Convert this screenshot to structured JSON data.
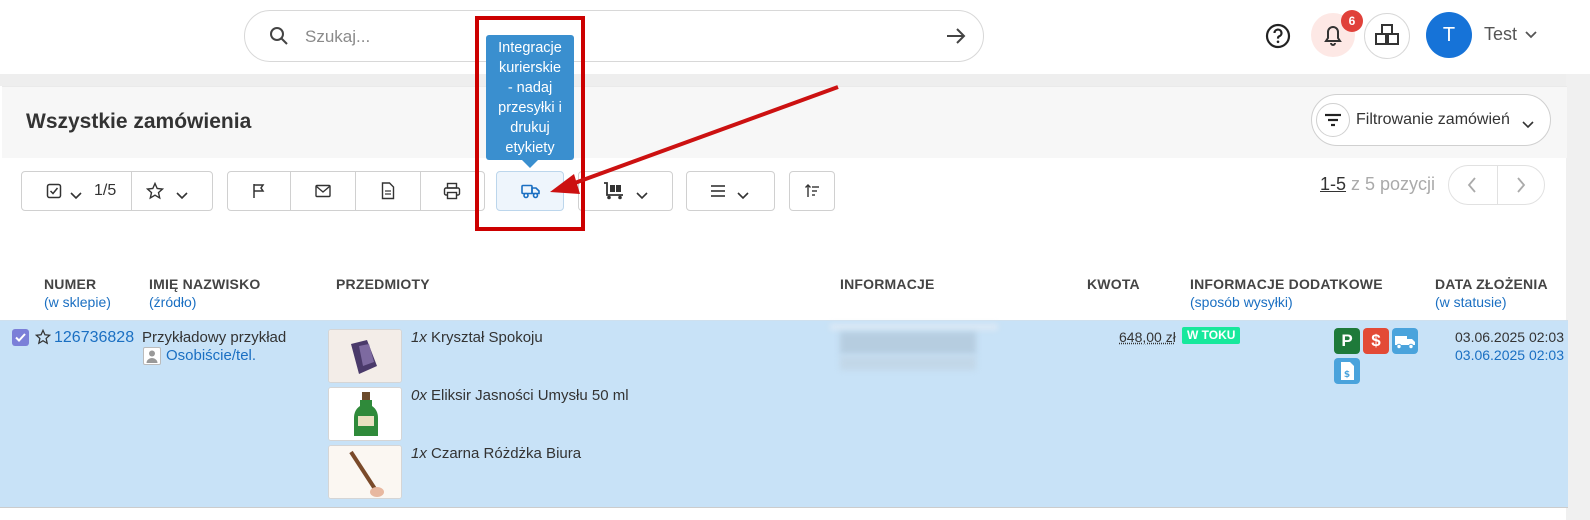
{
  "search": {
    "placeholder": "Szukaj..."
  },
  "header": {
    "notifications_count": "6",
    "avatar_initial": "T",
    "username": "Test"
  },
  "page": {
    "title": "Wszystkie zamówienia",
    "filter_label": "Filtrowanie zamówień"
  },
  "toolbar": {
    "selection_count": "1/5"
  },
  "tooltip": {
    "lines": [
      "Integracje",
      "kurierskie",
      "- nadaj",
      "przesyłki i",
      "drukuj",
      "etykiety"
    ]
  },
  "pagination": {
    "current": "1-5",
    "rest": " z 5 pozycji"
  },
  "table": {
    "headers": [
      {
        "label": "NUMER",
        "sub": "(w sklepie)"
      },
      {
        "label": "IMIĘ NAZWISKO",
        "sub": "(źródło)"
      },
      {
        "label": "PRZEDMIOTY",
        "sub": ""
      },
      {
        "label": "INFORMACJE",
        "sub": ""
      },
      {
        "label": "KWOTA",
        "sub": ""
      },
      {
        "label": "INFORMACJE DODATKOWE",
        "sub": "(sposób wysyłki)"
      },
      {
        "label": "DATA ZŁOŻENIA",
        "sub": "(w statusie)"
      }
    ],
    "rows": [
      {
        "order_number": "126736828",
        "customer_name": "Przykładowy przykład",
        "source": "Osobiście/tel.",
        "items": [
          {
            "qty": "1x",
            "name": " Kryształ Spokoju"
          },
          {
            "qty": "0x",
            "name": " Eliksir Jasności Umysłu 50 ml"
          },
          {
            "qty": "1x",
            "name": " Czarna Różdżka Biura"
          }
        ],
        "amount": "648,00 zł",
        "status": "W TOKU",
        "flags": [
          "P",
          "$"
        ],
        "date_created": "03.06.2025 02:03",
        "date_status": "03.06.2025 02:03"
      }
    ]
  },
  "colors": {
    "accent": "#1a6fc2",
    "row_selected": "#c8e2f7",
    "tooltip": "#3a8fcf",
    "highlight": "#cc0000",
    "status": "#17e89c"
  }
}
